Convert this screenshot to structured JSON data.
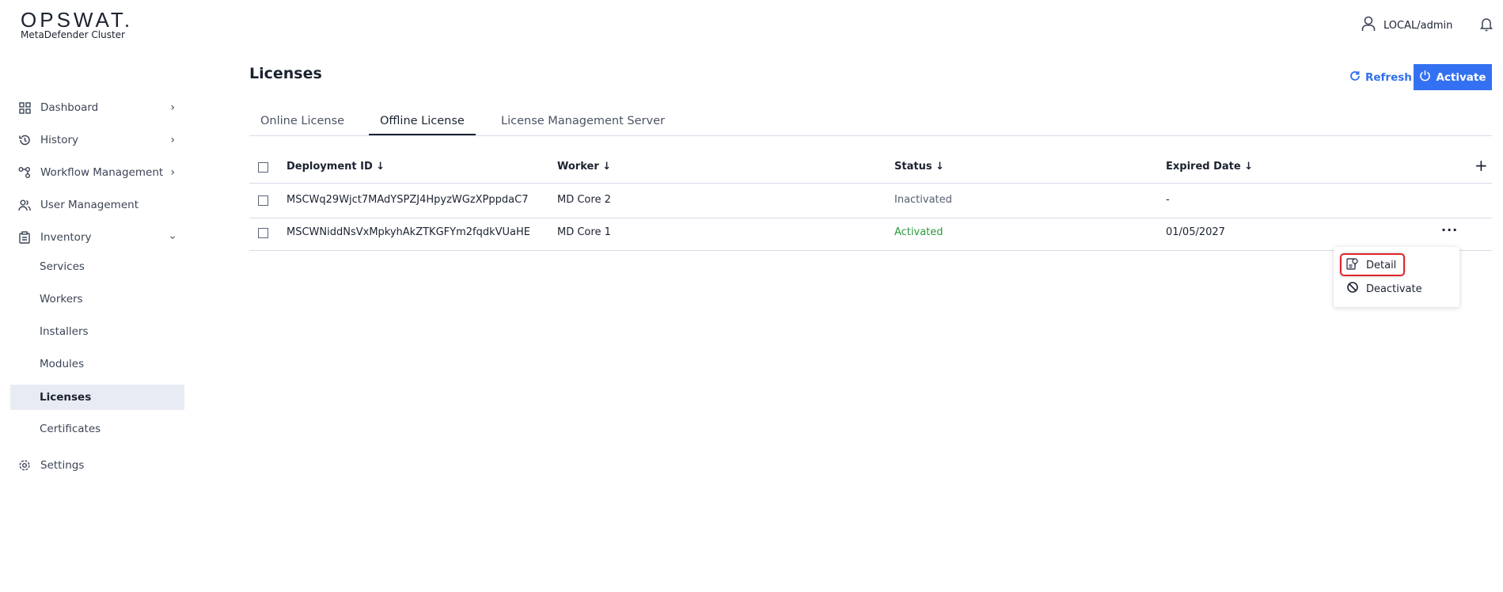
{
  "brand": {
    "logo": "OPSWAT.",
    "product": "MetaDefender Cluster"
  },
  "header": {
    "user": "LOCAL/admin"
  },
  "sidebar": {
    "items": [
      {
        "label": "Dashboard"
      },
      {
        "label": "History"
      },
      {
        "label": "Workflow Management"
      },
      {
        "label": "User Management"
      },
      {
        "label": "Inventory"
      },
      {
        "label": "Services"
      },
      {
        "label": "Workers"
      },
      {
        "label": "Installers"
      },
      {
        "label": "Modules"
      },
      {
        "label": "Licenses"
      },
      {
        "label": "Certificates"
      },
      {
        "label": "Settings"
      }
    ]
  },
  "page": {
    "title": "Licenses",
    "refresh_label": "Refresh",
    "activate_label": "Activate"
  },
  "tabs": [
    {
      "label": "Online License"
    },
    {
      "label": "Offline License"
    },
    {
      "label": "License Management Server"
    }
  ],
  "table": {
    "columns": [
      {
        "label": "Deployment ID",
        "sort": "↓"
      },
      {
        "label": "Worker",
        "sort": "↓"
      },
      {
        "label": "Status",
        "sort": "↓"
      },
      {
        "label": "Expired Date",
        "sort": "↓"
      }
    ],
    "rows": [
      {
        "id": "MSCWq29Wjct7MAdYSPZJ4HpyzWGzXPppdaC7",
        "worker": "MD Core 2",
        "status": "Inactivated",
        "expired": "-"
      },
      {
        "id": "MSCWNiddNsVxMpkyhAkZTKGFYm2fqdkVUaHE",
        "worker": "MD Core 1",
        "status": "Activated",
        "expired": "01/05/2027"
      }
    ]
  },
  "menu": {
    "items": [
      {
        "label": "Detail"
      },
      {
        "label": "Deactivate"
      }
    ]
  },
  "colors": {
    "accent": "#3471f2",
    "activated": "#2a9a3a",
    "highlight": "#e0262c"
  }
}
